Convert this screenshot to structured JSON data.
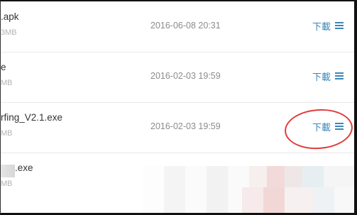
{
  "files": [
    {
      "name": ".apk",
      "size": "3MB",
      "date": "2016-06-08 20:31",
      "action": "下載"
    },
    {
      "name": "e",
      "size": "MB",
      "date": "2016-02-03 19:59",
      "action": "下載"
    },
    {
      "name": "rfing_V2.1.exe",
      "size": "MB",
      "date": "2016-02-03 19:59",
      "action": "下載"
    },
    {
      "name": ".exe",
      "size": "MB",
      "date": "",
      "action": ""
    }
  ],
  "icons": {
    "menu": "menu-icon"
  },
  "colors": {
    "action_link": "#3c87b7",
    "annotation": "#e23b3b",
    "date_text": "#8c8c8c",
    "size_text": "#b4b4b4"
  }
}
